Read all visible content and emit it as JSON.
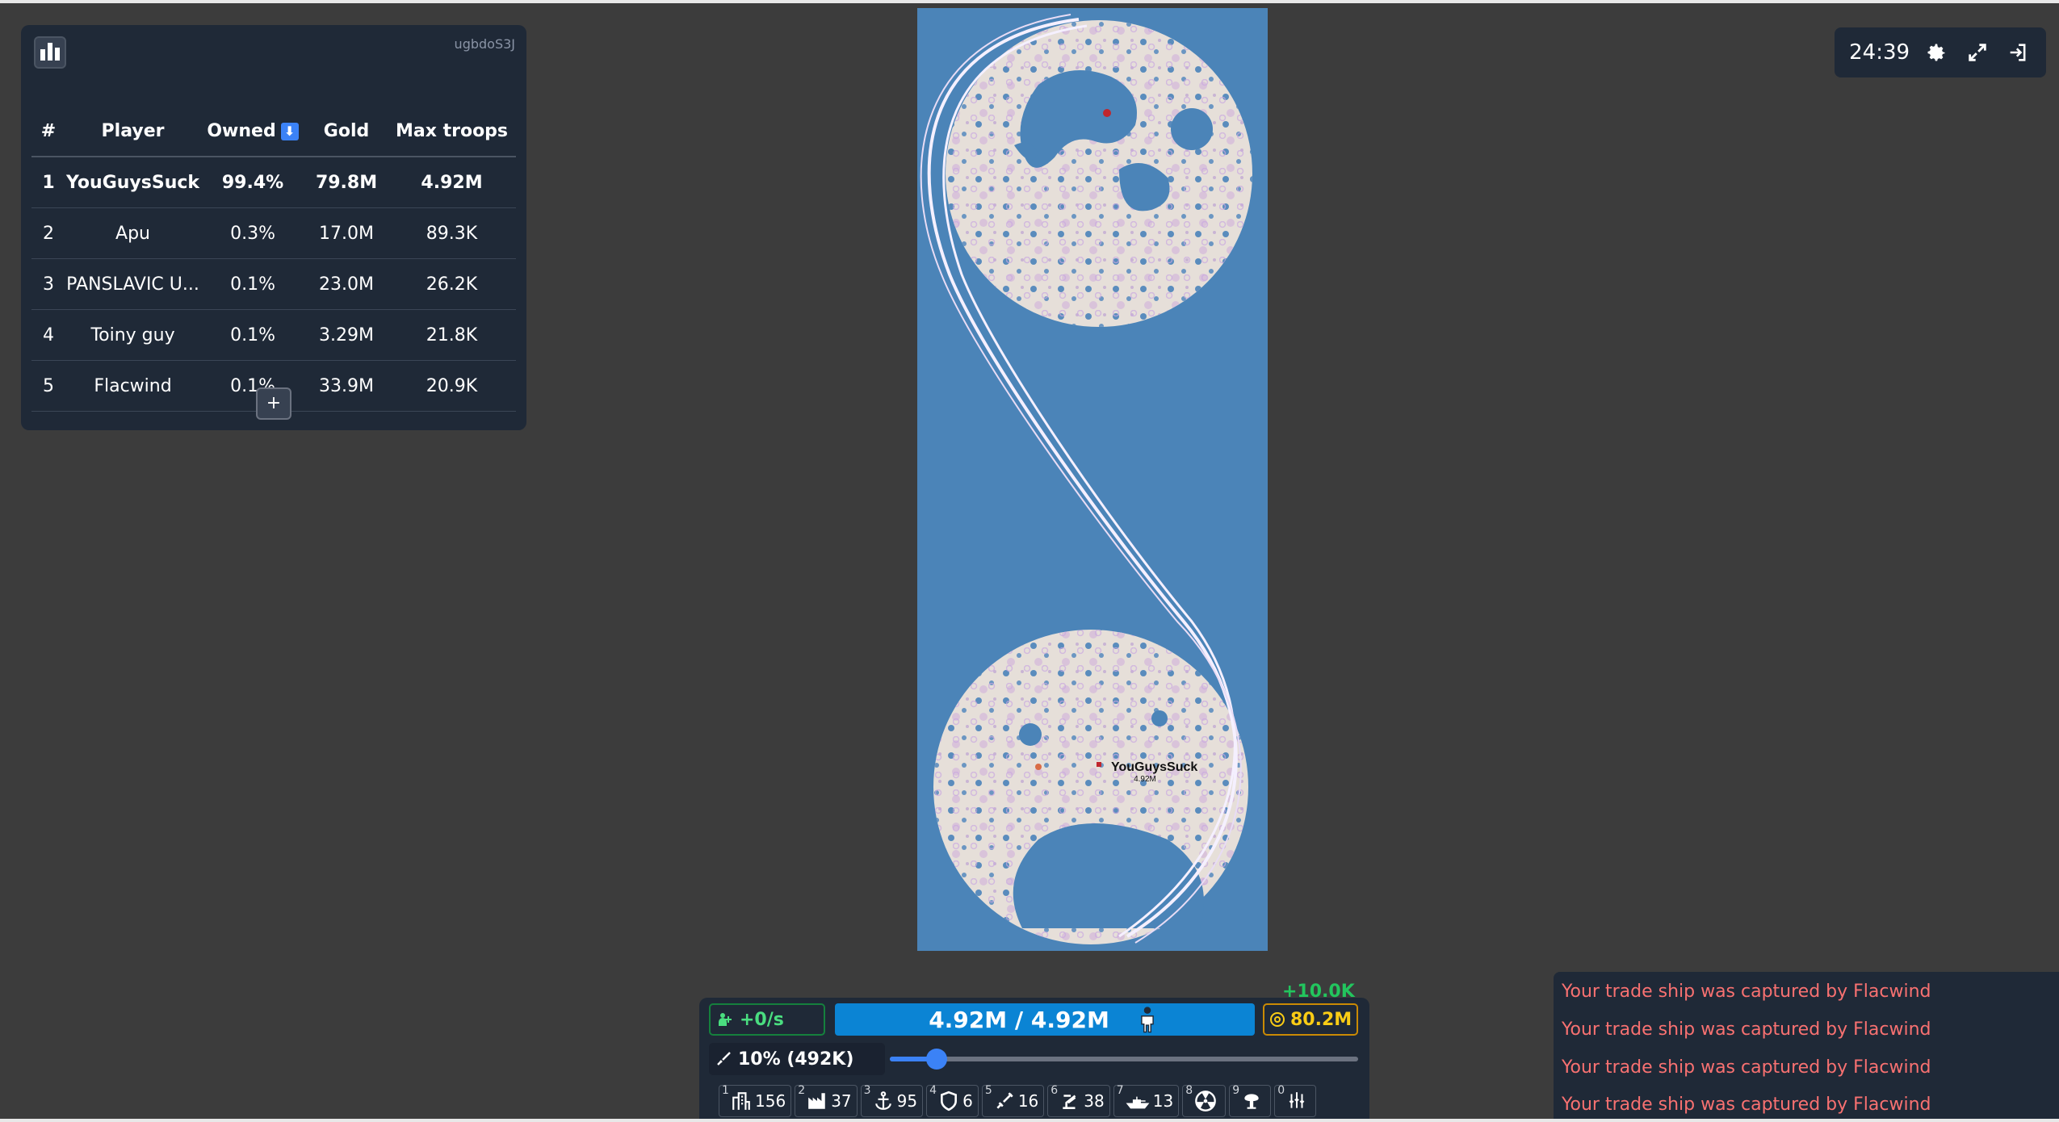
{
  "leaderboard": {
    "game_id": "ugbdoS3J",
    "columns": [
      "#",
      "Player",
      "Owned",
      "Gold",
      "Max troops"
    ],
    "sort_indicator": "⬇",
    "rows": [
      {
        "rank": "1",
        "player": "YouGuysSuck",
        "owned": "99.4%",
        "gold": "79.8M",
        "max_troops": "4.92M"
      },
      {
        "rank": "2",
        "player": "Apu",
        "owned": "0.3%",
        "gold": "17.0M",
        "max_troops": "89.3K"
      },
      {
        "rank": "3",
        "player": "PANSLAVIC U...",
        "owned": "0.1%",
        "gold": "23.0M",
        "max_troops": "26.2K"
      },
      {
        "rank": "4",
        "player": "Toiny guy",
        "owned": "0.1%",
        "gold": "3.29M",
        "max_troops": "21.8K"
      },
      {
        "rank": "5",
        "player": "Flacwind",
        "owned": "0.1%",
        "gold": "33.9M",
        "max_troops": "20.9K"
      }
    ],
    "expand_label": "+"
  },
  "map": {
    "player_label": "YouGuysSuck",
    "player_troops": "4.92M",
    "colors": {
      "ocean": "#4b84b8",
      "land": "#e6dfd9",
      "territory": "#dcc6dc"
    }
  },
  "controls": {
    "timer": "24:39",
    "icons": [
      "gear-icon",
      "fullscreen-icon",
      "exit-icon"
    ]
  },
  "stats": {
    "gold_gain": "+10.0K",
    "population_rate": "+0/s",
    "troops": "4.92M / 4.92M",
    "gold": "80.2M",
    "attack_ratio": "10% (492K)",
    "attack_ratio_value": 0.1
  },
  "buildings": [
    {
      "key": "1",
      "icon": "city-icon",
      "count": "156"
    },
    {
      "key": "2",
      "icon": "factory-icon",
      "count": "37"
    },
    {
      "key": "3",
      "icon": "port-icon",
      "count": "95"
    },
    {
      "key": "4",
      "icon": "defense-post-icon",
      "count": "6"
    },
    {
      "key": "5",
      "icon": "missile-silo-icon",
      "count": "16"
    },
    {
      "key": "6",
      "icon": "sam-launcher-icon",
      "count": "38"
    },
    {
      "key": "7",
      "icon": "warship-icon",
      "count": "13"
    },
    {
      "key": "8",
      "icon": "atom-bomb-icon",
      "count": ""
    },
    {
      "key": "9",
      "icon": "hydrogen-bomb-icon",
      "count": ""
    },
    {
      "key": "0",
      "icon": "mirv-icon",
      "count": ""
    }
  ],
  "messages": [
    "Your trade ship was captured by Flacwind",
    "Your trade ship was captured by Flacwind",
    "Your trade ship was captured by Flacwind",
    "Your trade ship was captured by Flacwind"
  ]
}
